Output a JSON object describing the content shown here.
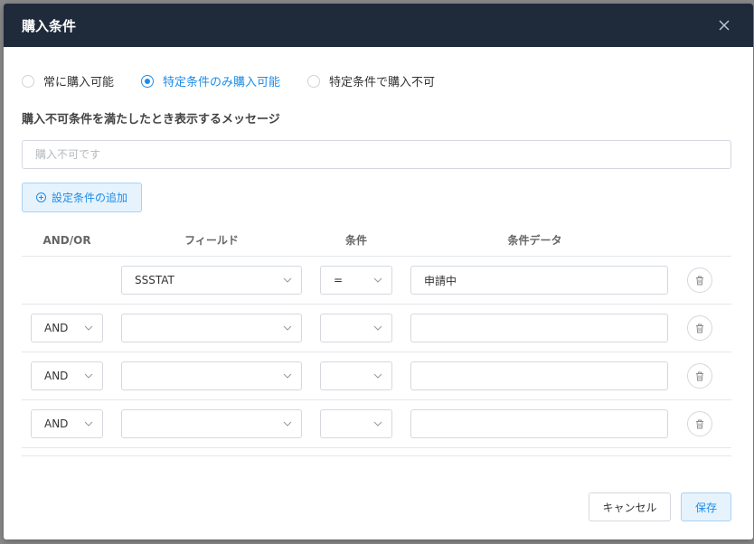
{
  "dialog": {
    "title": "購入条件"
  },
  "purchase_mode": {
    "options": [
      {
        "label": "常に購入可能",
        "checked": false
      },
      {
        "label": "特定条件のみ購入可能",
        "checked": true
      },
      {
        "label": "特定条件で購入不可",
        "checked": false
      }
    ]
  },
  "message": {
    "label": "購入不可条件を満たしたとき表示するメッセージ",
    "placeholder": "購入不可です",
    "value": ""
  },
  "add_condition_label": "設定条件の追加",
  "table": {
    "headers": {
      "andor": "AND/OR",
      "field": "フィールド",
      "condition": "条件",
      "data": "条件データ"
    },
    "rows": [
      {
        "andor": "",
        "field": "SSSTAT",
        "condition": "=",
        "data": "申請中"
      },
      {
        "andor": "AND",
        "field": "",
        "condition": "",
        "data": ""
      },
      {
        "andor": "AND",
        "field": "",
        "condition": "",
        "data": ""
      },
      {
        "andor": "AND",
        "field": "",
        "condition": "",
        "data": ""
      }
    ]
  },
  "footer": {
    "cancel_label": "キャンセル",
    "save_label": "保存"
  },
  "colors": {
    "header_bg": "#1f2a3b",
    "accent": "#1f8ce6",
    "accent_bg": "#e6f3fd"
  }
}
